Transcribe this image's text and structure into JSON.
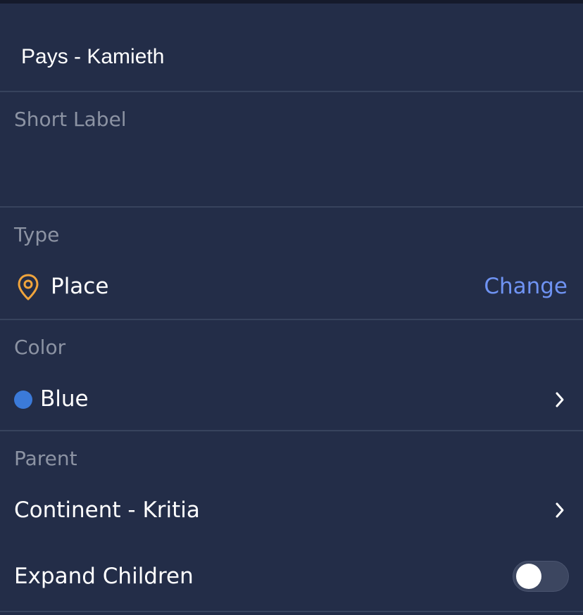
{
  "header": {
    "title_value": "Pays - Kamieth"
  },
  "short_label": {
    "label": "Short Label",
    "value": ""
  },
  "type": {
    "label": "Type",
    "value": "Place",
    "icon": "location-pin-icon",
    "icon_color": "#f0a43c",
    "change_label": "Change",
    "change_color": "#6f93f3"
  },
  "color": {
    "label": "Color",
    "value": "Blue",
    "swatch_color": "#3b7ad9"
  },
  "parent": {
    "label": "Parent",
    "value": "Continent - Kritia"
  },
  "expand_children": {
    "label": "Expand Children",
    "enabled": false
  }
}
